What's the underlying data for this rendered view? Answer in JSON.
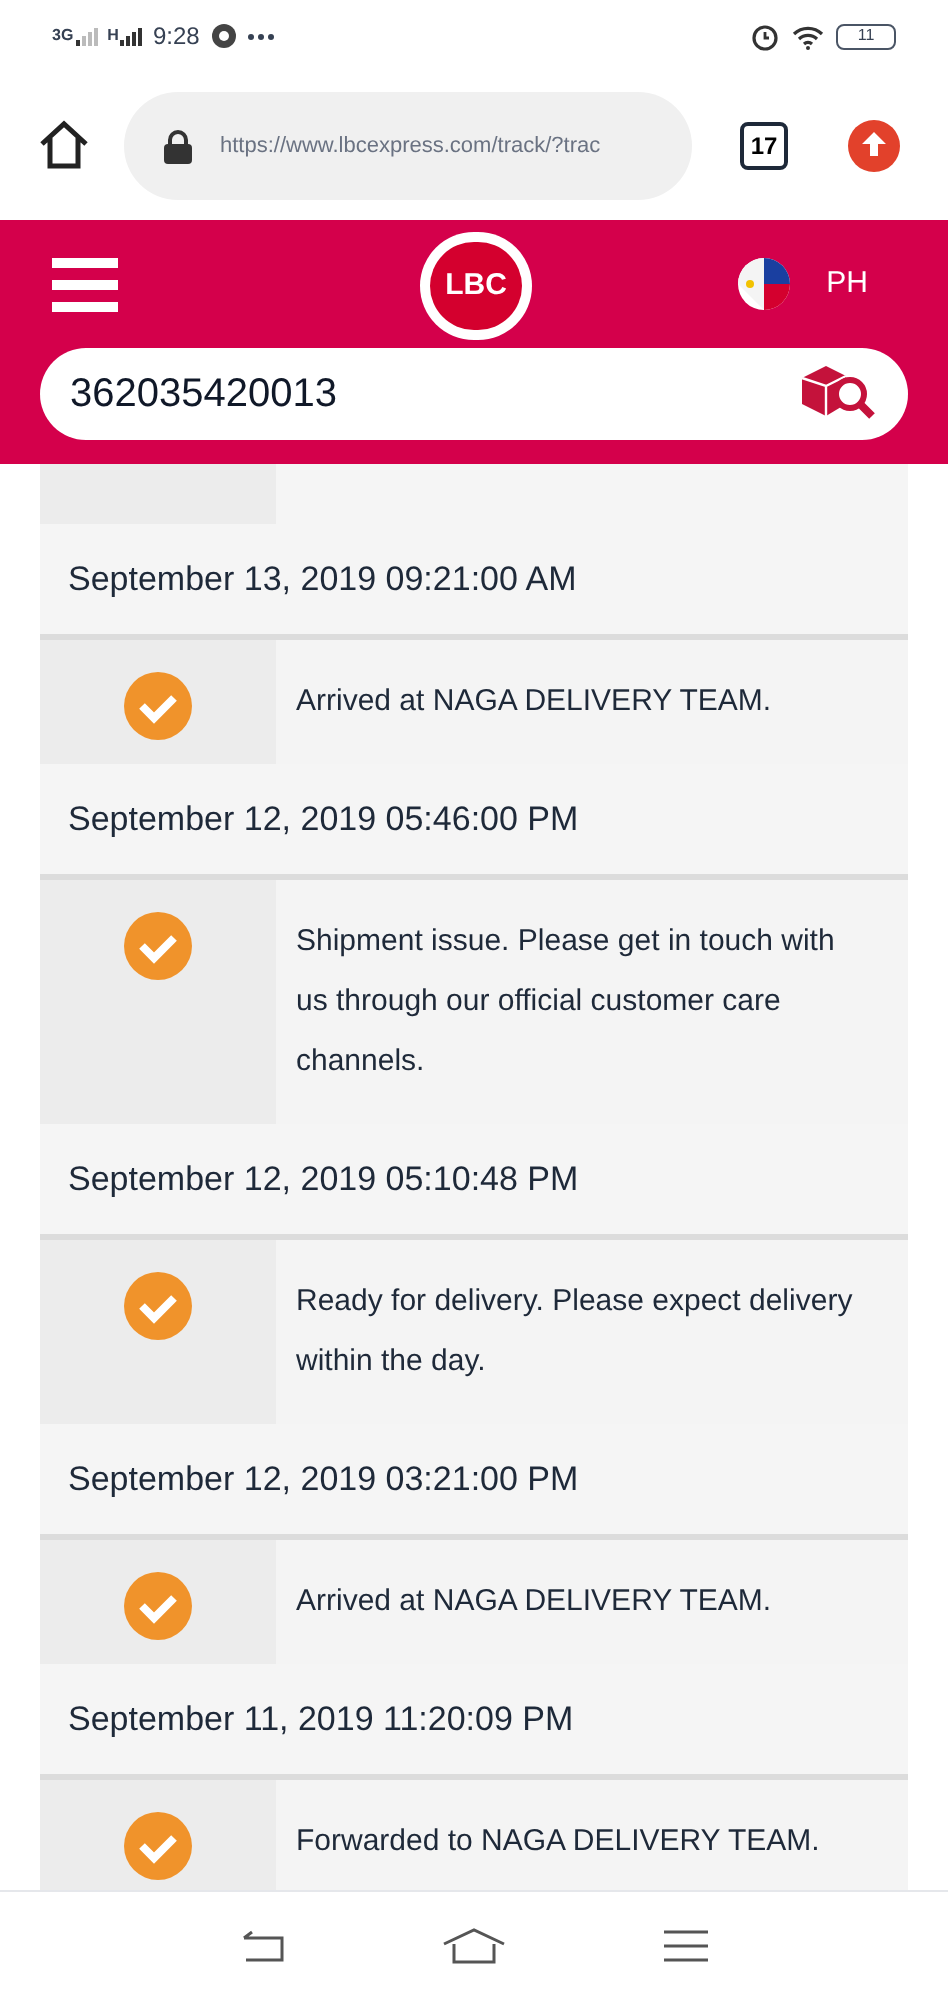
{
  "status_bar": {
    "network_1": "3G",
    "network_2": "H",
    "time": "9:28",
    "battery": "11"
  },
  "browser": {
    "url": "https://www.lbcexpress.com/track/?trac",
    "tab_count": "17"
  },
  "header": {
    "logo": "LBC",
    "country": "PH"
  },
  "search": {
    "value": "362035420013"
  },
  "timeline": [
    {
      "kind": "date",
      "text": "September 13, 2019 09:21:00 AM"
    },
    {
      "kind": "event",
      "text": "Arrived at NAGA DELIVERY TEAM."
    },
    {
      "kind": "date",
      "text": "September 12, 2019 05:46:00 PM"
    },
    {
      "kind": "event",
      "text": "Shipment issue. Please get in touch with us through our official customer care channels."
    },
    {
      "kind": "date",
      "text": "September 12, 2019 05:10:48 PM"
    },
    {
      "kind": "event",
      "text": "Ready for delivery. Please expect delivery within the day."
    },
    {
      "kind": "date",
      "text": "September 12, 2019 03:21:00 PM"
    },
    {
      "kind": "event",
      "text": "Arrived at NAGA DELIVERY TEAM."
    },
    {
      "kind": "date",
      "text": "September 11, 2019 11:20:09 PM"
    },
    {
      "kind": "event",
      "text": "Forwarded to NAGA DELIVERY TEAM."
    }
  ]
}
